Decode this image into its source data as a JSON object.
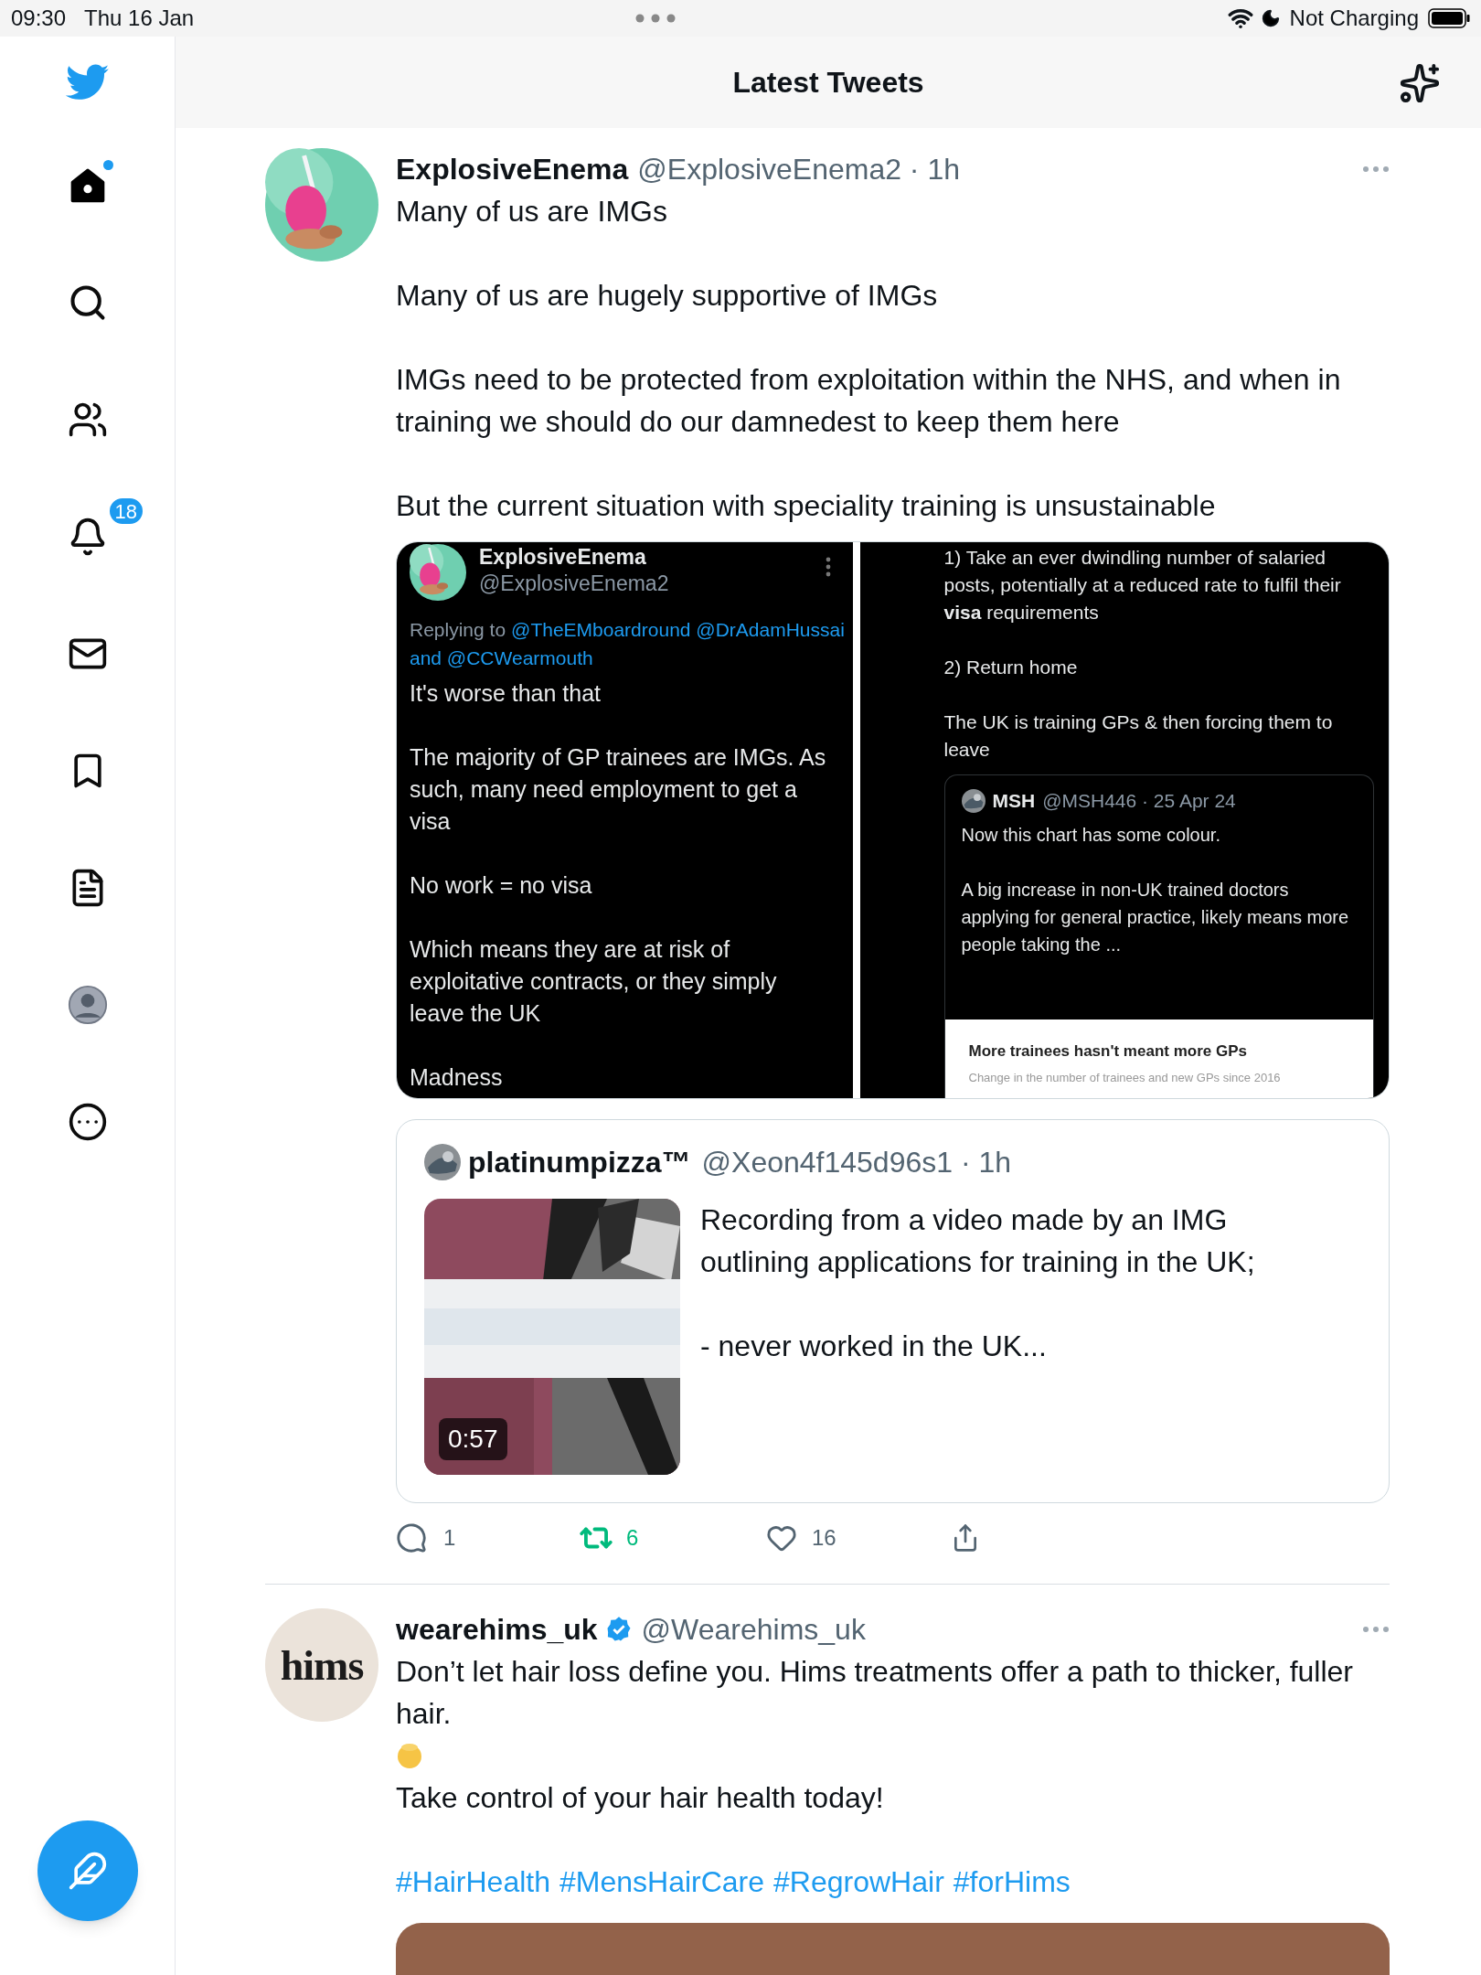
{
  "status_bar": {
    "time": "09:30",
    "date": "Thu 16 Jan",
    "charging": "Not Charging"
  },
  "sidebar": {
    "items": [
      {
        "kind": "home",
        "selected": true,
        "dot": true
      },
      {
        "kind": "search",
        "selected": false
      },
      {
        "kind": "communities",
        "selected": false
      },
      {
        "kind": "notifications",
        "selected": false,
        "badge": "18"
      },
      {
        "kind": "messages",
        "selected": false
      },
      {
        "kind": "bookmarks",
        "selected": false
      },
      {
        "kind": "lists",
        "selected": false
      },
      {
        "kind": "profile",
        "selected": false
      },
      {
        "kind": "more",
        "selected": false
      }
    ]
  },
  "header": {
    "title": "Latest Tweets"
  },
  "tweets": [
    {
      "name": "ExplosiveEnema",
      "handle": "@ExplosiveEnema2",
      "time": "· 1h",
      "body": [
        {
          "kind": "text",
          "text": "Many of us are IMGs"
        },
        {
          "kind": "text",
          "text": "Many of us are hugely supportive of IMGs"
        },
        {
          "kind": "text",
          "text": "IMGs need to be protected from exploitation within the NHS, and when in training we should do our damnedest to keep them here"
        },
        {
          "kind": "text",
          "text": "But the current situation with speciality training is unsustainable"
        }
      ],
      "media": {
        "kind": "screenshots",
        "left": {
          "name": "ExplosiveEnema",
          "handle": "@ExplosiveEnema2",
          "replying_label": "Replying to",
          "replying_lines": [
            "@TheEMboardround @DrAdamHussai",
            "and @CCWearmouth"
          ],
          "paragraphs": [
            "It's worse than that",
            "The majority of GP trainees are IMGs. As such, many need employment to get a visa",
            "No work = no visa",
            "Which means they are at risk of exploitative contracts, or they simply leave the UK",
            "Madness"
          ]
        },
        "right": {
          "paragraphs": [
            "1) Take an ever dwindling number of salaried posts, potentially at a reduced rate to fulfil their **visa** requirements",
            "2) Return home",
            "The UK is training GPs & then forcing them to leave"
          ],
          "quote": {
            "name": "MSH",
            "meta": "@MSH446 · 25 Apr 24",
            "paragraphs": [
              "Now this chart has some colour.",
              "A big increase in non-UK trained doctors applying for general practice, likely means more people taking the ..."
            ],
            "chart_title": "More trainees hasn't meant more GPs",
            "chart_subtitle": "Change in the number of trainees and new GPs since 2016"
          }
        }
      },
      "quote": {
        "name": "platinumpizza™",
        "handle": "@Xeon4f145d96s1",
        "time": "· 1h",
        "duration": "0:57",
        "paragraphs": [
          "Recording from a video made by an IMG outlining applications for training in the UK;",
          "- never worked in the UK..."
        ]
      },
      "actions": {
        "replies": "1",
        "retweets": "6",
        "retweeted": true,
        "likes": "16",
        "liked": false
      }
    },
    {
      "name": "wearehims_uk",
      "handle": "@Wearehims_uk",
      "verified": true,
      "avatar_text": "hims",
      "body": [
        {
          "kind": "text",
          "text": "Don’t let hair loss define you. Hims treatments offer a path to thicker, fuller hair."
        },
        {
          "kind": "emoji"
        },
        {
          "kind": "text",
          "text": "Take control of your hair health today!"
        },
        {
          "kind": "hashtags",
          "tags": [
            "#HairHealth",
            "#MensHairCare",
            "#RegrowHair",
            "#forHims"
          ]
        }
      ],
      "media": {
        "kind": "picture"
      }
    }
  ]
}
